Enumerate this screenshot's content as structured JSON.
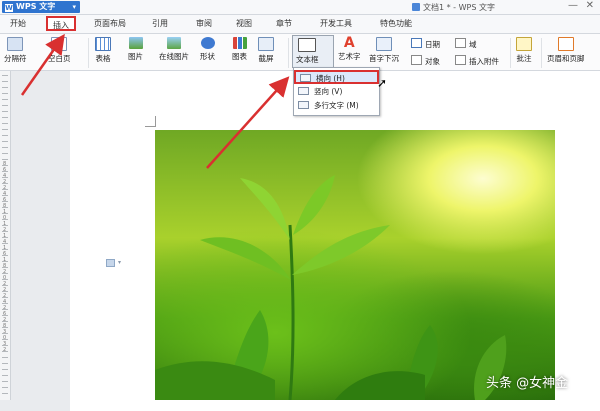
{
  "titlebar": {
    "app_name": "WPS 文字",
    "app_caret": "▾",
    "document_title": "文档1 * - WPS 文字",
    "min_glyph": "—",
    "close_glyph": "✕"
  },
  "menu": {
    "tabs": [
      "开始",
      "插入",
      "页面布局",
      "引用",
      "审阅",
      "视图",
      "章节",
      "开发工具",
      "特色功能"
    ],
    "active_tab": "插入"
  },
  "ribbon": {
    "page_break": "分隔符",
    "blank_page": "空白页",
    "table": "表格",
    "picture": "图片",
    "online_picture": "在线图片",
    "shapes": "形状",
    "chart": "图表",
    "screenshot": "截屏",
    "textbox": "文本框",
    "wordart": "艺术字",
    "drop_cap": "首字下沉",
    "date": "日期",
    "field": "域",
    "object": "对象",
    "insert_attachment": "插入附件",
    "comment": "批注",
    "header_footer": "页眉和页脚"
  },
  "textbox_menu": {
    "items": [
      "横向 (H)",
      "竖向 (V)",
      "多行文字 (M)"
    ],
    "highlighted_index": 0
  },
  "ruler": {
    "marks_text": "8 6 4 2 2 4 6 8 10 12 14 16 18 20 22 24 26 28 30 32"
  },
  "watermark": "头条 @女神金",
  "colors": {
    "accent": "#2f74cf",
    "highlight_box": "#d93030"
  }
}
